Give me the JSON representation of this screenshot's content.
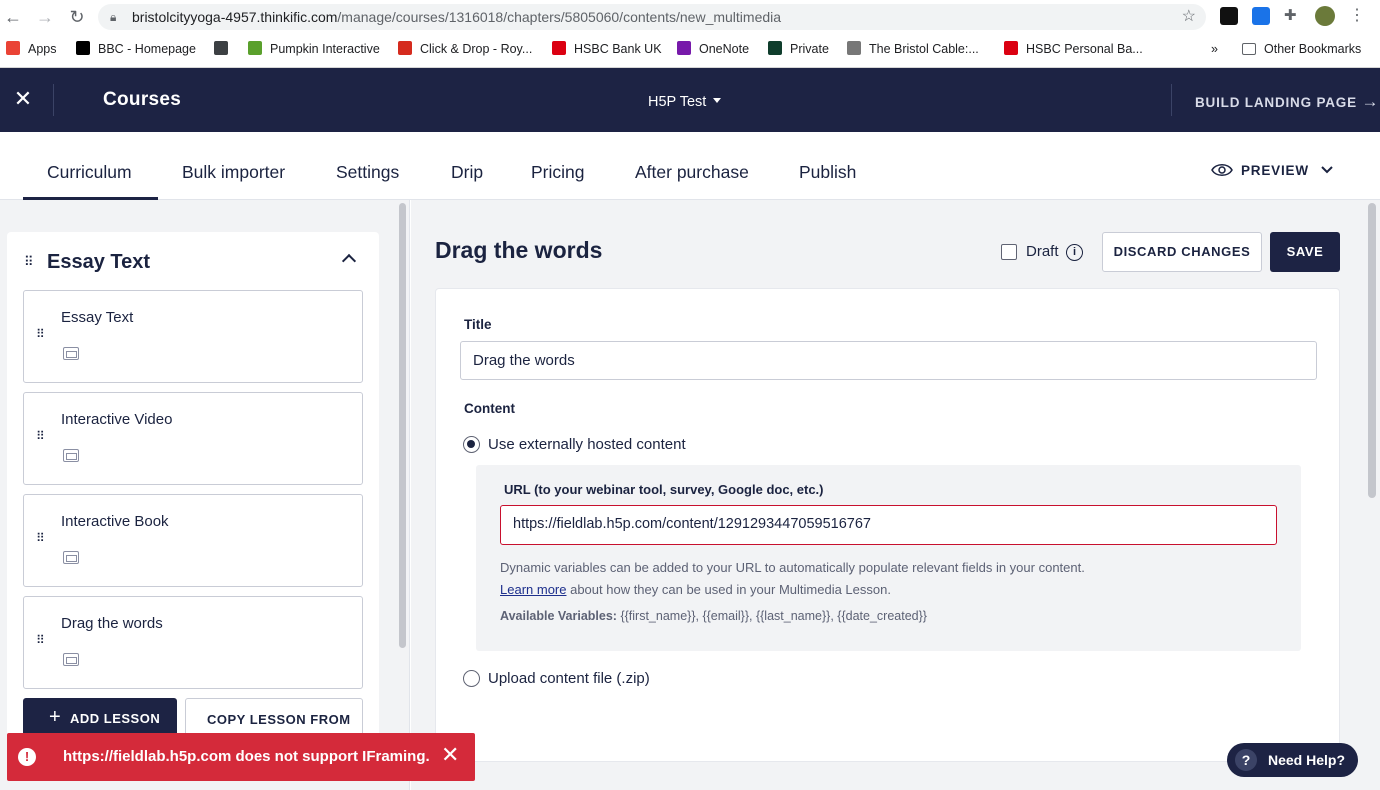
{
  "browser": {
    "url_host": "bristolcityyoga-4957.thinkific.com",
    "url_path": "/manage/courses/1316018/chapters/5805060/contents/new_multimedia",
    "bookmarks": [
      {
        "label": "Apps",
        "color": "#ea4335"
      },
      {
        "label": "BBC - Homepage",
        "color": "#000000"
      },
      {
        "label": "",
        "color": "#3c4043"
      },
      {
        "label": "Pumpkin Interactive",
        "color": "#5aa02c"
      },
      {
        "label": "Click & Drop - Roy...",
        "color": "#d52b1e"
      },
      {
        "label": "HSBC Bank UK",
        "color": "#db0011"
      },
      {
        "label": "OneNote",
        "color": "#7719aa"
      },
      {
        "label": "Private",
        "color": "#0f3d2c"
      },
      {
        "label": "The Bristol Cable:...",
        "color": "#777777"
      },
      {
        "label": "HSBC Personal Ba...",
        "color": "#db0011"
      }
    ],
    "more_bookmarks": "»",
    "other_bookmarks": "Other Bookmarks"
  },
  "appbar": {
    "close_glyph": "✕",
    "section": "Courses",
    "course_name": "H5P Test",
    "landing_label": "BUILD LANDING PAGE",
    "landing_arrow": "→"
  },
  "tabs": [
    {
      "label": "Curriculum",
      "active": true
    },
    {
      "label": "Bulk importer"
    },
    {
      "label": "Settings"
    },
    {
      "label": "Drip"
    },
    {
      "label": "Pricing"
    },
    {
      "label": "After purchase"
    },
    {
      "label": "Publish"
    }
  ],
  "preview_label": "PREVIEW",
  "sidebar": {
    "chapter_title": "Essay Text",
    "lessons": [
      {
        "name": "Essay Text"
      },
      {
        "name": "Interactive Video"
      },
      {
        "name": "Interactive Book"
      },
      {
        "name": "Drag the words"
      }
    ],
    "add_lesson": "ADD LESSON",
    "copy_lesson": "COPY LESSON FROM"
  },
  "main": {
    "heading": "Drag the words",
    "draft_label": "Draft",
    "draft_checked": false,
    "discard_label": "DISCARD CHANGES",
    "save_label": "SAVE",
    "title_label": "Title",
    "title_value": "Drag the words",
    "content_label": "Content",
    "option_external": "Use externally hosted content",
    "option_upload": "Upload content file (.zip)",
    "selected_option": "external",
    "url_label": "URL (to your webinar tool, survey, Google doc, etc.)",
    "url_value": "https://fieldlab.h5p.com/content/1291293447059516767",
    "help_text": "Dynamic variables can be added to your URL to automatically populate relevant fields in your content.",
    "learn_more": "Learn more",
    "learn_more_tail": " about how they can be used in your Multimedia Lesson.",
    "vars_label": "Available Variables:",
    "vars_value": " {{first_name}}, {{email}}, {{last_name}}, {{date_created}}"
  },
  "toast": {
    "message": "https://fieldlab.h5p.com does not support IFraming.",
    "close_glyph": "✕",
    "icon_glyph": "!"
  },
  "help_button": {
    "q": "?",
    "label": "Need Help?"
  },
  "colors": {
    "navy": "#1d2344",
    "error": "#d42a3a",
    "input_error_border": "#c8102e"
  }
}
